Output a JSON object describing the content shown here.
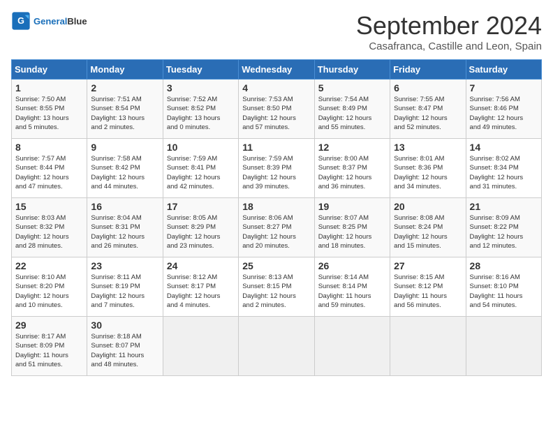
{
  "logo": {
    "text1": "General",
    "text2": "Blue"
  },
  "title": "September 2024",
  "location": "Casafranca, Castille and Leon, Spain",
  "headers": [
    "Sunday",
    "Monday",
    "Tuesday",
    "Wednesday",
    "Thursday",
    "Friday",
    "Saturday"
  ],
  "weeks": [
    [
      {
        "day": "1",
        "lines": [
          "Sunrise: 7:50 AM",
          "Sunset: 8:55 PM",
          "Daylight: 13 hours",
          "and 5 minutes."
        ]
      },
      {
        "day": "2",
        "lines": [
          "Sunrise: 7:51 AM",
          "Sunset: 8:54 PM",
          "Daylight: 13 hours",
          "and 2 minutes."
        ]
      },
      {
        "day": "3",
        "lines": [
          "Sunrise: 7:52 AM",
          "Sunset: 8:52 PM",
          "Daylight: 13 hours",
          "and 0 minutes."
        ]
      },
      {
        "day": "4",
        "lines": [
          "Sunrise: 7:53 AM",
          "Sunset: 8:50 PM",
          "Daylight: 12 hours",
          "and 57 minutes."
        ]
      },
      {
        "day": "5",
        "lines": [
          "Sunrise: 7:54 AM",
          "Sunset: 8:49 PM",
          "Daylight: 12 hours",
          "and 55 minutes."
        ]
      },
      {
        "day": "6",
        "lines": [
          "Sunrise: 7:55 AM",
          "Sunset: 8:47 PM",
          "Daylight: 12 hours",
          "and 52 minutes."
        ]
      },
      {
        "day": "7",
        "lines": [
          "Sunrise: 7:56 AM",
          "Sunset: 8:46 PM",
          "Daylight: 12 hours",
          "and 49 minutes."
        ]
      }
    ],
    [
      {
        "day": "8",
        "lines": [
          "Sunrise: 7:57 AM",
          "Sunset: 8:44 PM",
          "Daylight: 12 hours",
          "and 47 minutes."
        ]
      },
      {
        "day": "9",
        "lines": [
          "Sunrise: 7:58 AM",
          "Sunset: 8:42 PM",
          "Daylight: 12 hours",
          "and 44 minutes."
        ]
      },
      {
        "day": "10",
        "lines": [
          "Sunrise: 7:59 AM",
          "Sunset: 8:41 PM",
          "Daylight: 12 hours",
          "and 42 minutes."
        ]
      },
      {
        "day": "11",
        "lines": [
          "Sunrise: 7:59 AM",
          "Sunset: 8:39 PM",
          "Daylight: 12 hours",
          "and 39 minutes."
        ]
      },
      {
        "day": "12",
        "lines": [
          "Sunrise: 8:00 AM",
          "Sunset: 8:37 PM",
          "Daylight: 12 hours",
          "and 36 minutes."
        ]
      },
      {
        "day": "13",
        "lines": [
          "Sunrise: 8:01 AM",
          "Sunset: 8:36 PM",
          "Daylight: 12 hours",
          "and 34 minutes."
        ]
      },
      {
        "day": "14",
        "lines": [
          "Sunrise: 8:02 AM",
          "Sunset: 8:34 PM",
          "Daylight: 12 hours",
          "and 31 minutes."
        ]
      }
    ],
    [
      {
        "day": "15",
        "lines": [
          "Sunrise: 8:03 AM",
          "Sunset: 8:32 PM",
          "Daylight: 12 hours",
          "and 28 minutes."
        ]
      },
      {
        "day": "16",
        "lines": [
          "Sunrise: 8:04 AM",
          "Sunset: 8:31 PM",
          "Daylight: 12 hours",
          "and 26 minutes."
        ]
      },
      {
        "day": "17",
        "lines": [
          "Sunrise: 8:05 AM",
          "Sunset: 8:29 PM",
          "Daylight: 12 hours",
          "and 23 minutes."
        ]
      },
      {
        "day": "18",
        "lines": [
          "Sunrise: 8:06 AM",
          "Sunset: 8:27 PM",
          "Daylight: 12 hours",
          "and 20 minutes."
        ]
      },
      {
        "day": "19",
        "lines": [
          "Sunrise: 8:07 AM",
          "Sunset: 8:25 PM",
          "Daylight: 12 hours",
          "and 18 minutes."
        ]
      },
      {
        "day": "20",
        "lines": [
          "Sunrise: 8:08 AM",
          "Sunset: 8:24 PM",
          "Daylight: 12 hours",
          "and 15 minutes."
        ]
      },
      {
        "day": "21",
        "lines": [
          "Sunrise: 8:09 AM",
          "Sunset: 8:22 PM",
          "Daylight: 12 hours",
          "and 12 minutes."
        ]
      }
    ],
    [
      {
        "day": "22",
        "lines": [
          "Sunrise: 8:10 AM",
          "Sunset: 8:20 PM",
          "Daylight: 12 hours",
          "and 10 minutes."
        ]
      },
      {
        "day": "23",
        "lines": [
          "Sunrise: 8:11 AM",
          "Sunset: 8:19 PM",
          "Daylight: 12 hours",
          "and 7 minutes."
        ]
      },
      {
        "day": "24",
        "lines": [
          "Sunrise: 8:12 AM",
          "Sunset: 8:17 PM",
          "Daylight: 12 hours",
          "and 4 minutes."
        ]
      },
      {
        "day": "25",
        "lines": [
          "Sunrise: 8:13 AM",
          "Sunset: 8:15 PM",
          "Daylight: 12 hours",
          "and 2 minutes."
        ]
      },
      {
        "day": "26",
        "lines": [
          "Sunrise: 8:14 AM",
          "Sunset: 8:14 PM",
          "Daylight: 11 hours",
          "and 59 minutes."
        ]
      },
      {
        "day": "27",
        "lines": [
          "Sunrise: 8:15 AM",
          "Sunset: 8:12 PM",
          "Daylight: 11 hours",
          "and 56 minutes."
        ]
      },
      {
        "day": "28",
        "lines": [
          "Sunrise: 8:16 AM",
          "Sunset: 8:10 PM",
          "Daylight: 11 hours",
          "and 54 minutes."
        ]
      }
    ],
    [
      {
        "day": "29",
        "lines": [
          "Sunrise: 8:17 AM",
          "Sunset: 8:09 PM",
          "Daylight: 11 hours",
          "and 51 minutes."
        ]
      },
      {
        "day": "30",
        "lines": [
          "Sunrise: 8:18 AM",
          "Sunset: 8:07 PM",
          "Daylight: 11 hours",
          "and 48 minutes."
        ]
      },
      null,
      null,
      null,
      null,
      null
    ]
  ]
}
